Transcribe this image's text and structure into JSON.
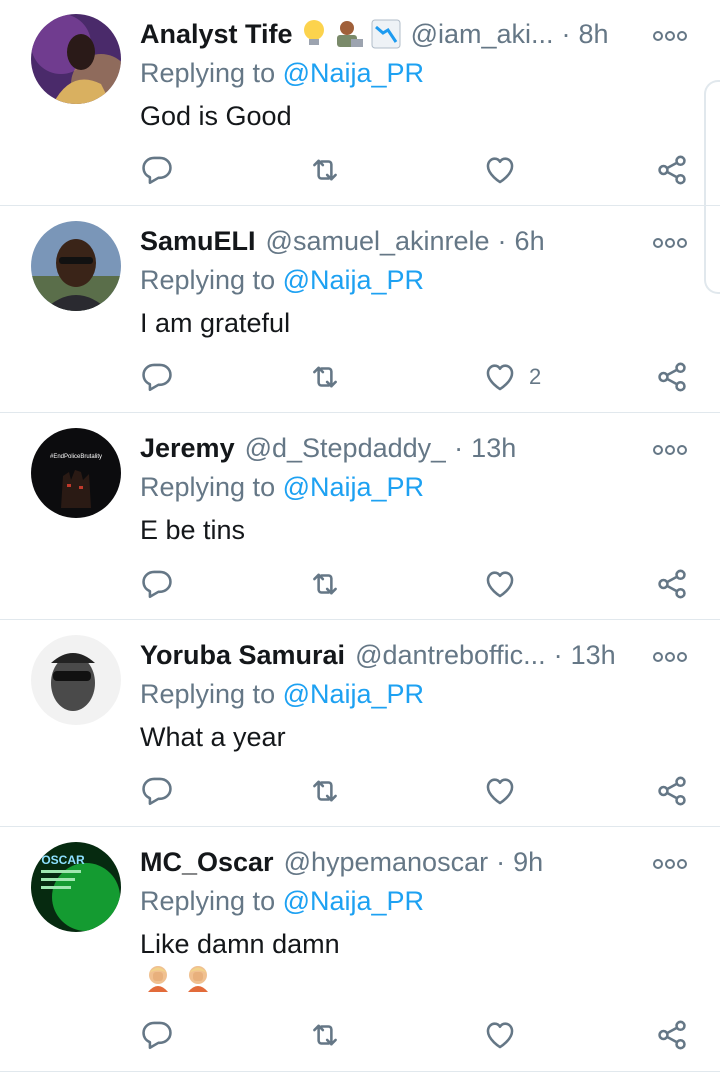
{
  "tweets": [
    {
      "display_name": "Analyst Tife",
      "handle": "@iam_aki...",
      "time": "8h",
      "replying_prefix": "Replying to ",
      "replying_to": "@Naija_PR",
      "text": "God is Good",
      "like_count": "",
      "name_emojis": [
        "light-bulb-emoji",
        "technologist-emoji",
        "chart-decreasing-emoji"
      ],
      "avatar": "avatar-analyst-tife"
    },
    {
      "display_name": "SamuELI",
      "handle": "@samuel_akinrele",
      "time": "6h",
      "replying_prefix": "Replying to ",
      "replying_to": "@Naija_PR",
      "text": "I am grateful",
      "like_count": "2",
      "avatar": "avatar-samueli"
    },
    {
      "display_name": "Jeremy",
      "handle": "@d_Stepdaddy_",
      "time": "13h",
      "replying_prefix": "Replying to ",
      "replying_to": "@Naija_PR",
      "text": "E be tins",
      "like_count": "",
      "avatar_text": "#EndPoliceBrutality",
      "avatar": "avatar-jeremy"
    },
    {
      "display_name": "Yoruba Samurai",
      "handle": "@dantreboffic...",
      "time": "13h",
      "replying_prefix": "Replying to ",
      "replying_to": "@Naija_PR",
      "text": "What a year",
      "like_count": "",
      "avatar": "avatar-yoruba-samurai"
    },
    {
      "display_name": "MC_Oscar",
      "handle": "@hypemanoscar",
      "time": "9h",
      "replying_prefix": "Replying to ",
      "replying_to": "@Naija_PR",
      "text": "Like damn damn",
      "like_count": "",
      "text_emojis": [
        "facepalm-emoji",
        "facepalm-emoji"
      ],
      "avatar_text": "OSCAR",
      "avatar": "avatar-mc-oscar"
    }
  ],
  "dot_separator": "·",
  "colors": {
    "accent": "#1da1f2",
    "secondary_text": "#657786",
    "primary_text": "#14171a",
    "divider": "#e1e8ed"
  },
  "icons": {
    "reply": "reply-icon",
    "retweet": "retweet-icon",
    "like": "heart-icon",
    "share": "share-icon",
    "more": "more-icon"
  }
}
